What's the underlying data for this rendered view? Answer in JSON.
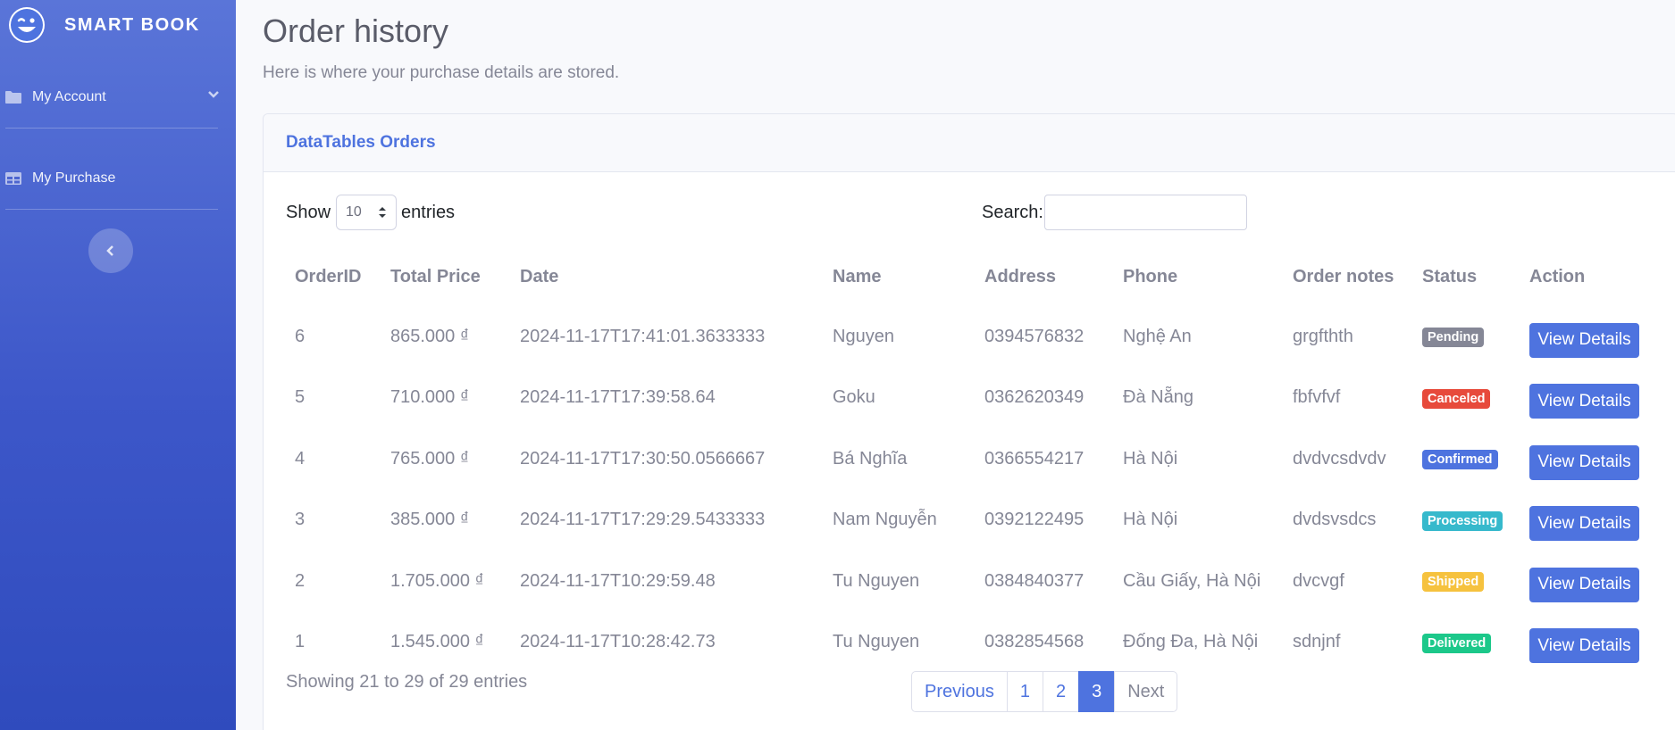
{
  "brand": {
    "name": "SMART BOOK",
    "logo_icon": "smiley-wink-icon"
  },
  "sidebar": {
    "items": [
      {
        "label": "My Account",
        "icon": "folder-icon"
      },
      {
        "label": "My Purchase",
        "icon": "table-icon"
      }
    ]
  },
  "page": {
    "title": "Order history",
    "subtitle": "Here is where your purchase details are stored."
  },
  "card": {
    "title": "DataTables Orders"
  },
  "controls": {
    "show_label": "Show",
    "entries_value": "10",
    "entries_label": "entries",
    "search_label": "Search:",
    "search_value": ""
  },
  "table": {
    "headers": [
      "OrderID",
      "Total Price",
      "Date",
      "Name",
      "Address",
      "Phone",
      "Order notes",
      "Status",
      "Action"
    ],
    "rows": [
      {
        "id": "6",
        "price": "865.000 ₫",
        "date": "2024-11-17T17:41:01.3633333",
        "name": "Nguyen",
        "address": "0394576832",
        "phone": "Nghệ An",
        "notes": "grgfthth",
        "status": "Pending",
        "status_color": "#858796",
        "action": "View Details"
      },
      {
        "id": "5",
        "price": "710.000 ₫",
        "date": "2024-11-17T17:39:58.64",
        "name": "Goku",
        "address": "0362620349",
        "phone": "Đà Nẵng",
        "notes": "fbfvfvf",
        "status": "Canceled",
        "status_color": "#e74a3b",
        "action": "View Details"
      },
      {
        "id": "4",
        "price": "765.000 ₫",
        "date": "2024-11-17T17:30:50.0566667",
        "name": "Bá Nghĩa",
        "address": "0366554217",
        "phone": "Hà Nội",
        "notes": "dvdvcsdvdv",
        "status": "Confirmed",
        "status_color": "#4e73df",
        "action": "View Details"
      },
      {
        "id": "3",
        "price": "385.000 ₫",
        "date": "2024-11-17T17:29:29.5433333",
        "name": "Nam Nguyễn",
        "address": "0392122495",
        "phone": "Hà Nội",
        "notes": "dvdsvsdcs",
        "status": "Processing",
        "status_color": "#36b9cc",
        "action": "View Details"
      },
      {
        "id": "2",
        "price": "1.705.000 ₫",
        "date": "2024-11-17T10:29:59.48",
        "name": "Tu Nguyen",
        "address": "0384840377",
        "phone": "Cầu Giấy, Hà Nội",
        "notes": "dvcvgf",
        "status": "Shipped",
        "status_color": "#f6c23e",
        "action": "View Details"
      },
      {
        "id": "1",
        "price": "1.545.000 ₫",
        "date": "2024-11-17T10:28:42.73",
        "name": "Tu Nguyen",
        "address": "0382854568",
        "phone": "Đống Đa, Hà Nội",
        "notes": "sdnjnf",
        "status": "Delivered",
        "status_color": "#1cc88a",
        "action": "View Details"
      }
    ]
  },
  "footer": {
    "info": "Showing 21 to 29 of 29 entries",
    "pagination": {
      "previous": "Previous",
      "pages": [
        "1",
        "2",
        "3"
      ],
      "active": "3",
      "next": "Next"
    }
  },
  "colors": {
    "primary": "#4e73df",
    "sidebar_top": "#5a75d8",
    "sidebar_bottom": "#2f4bbd"
  }
}
